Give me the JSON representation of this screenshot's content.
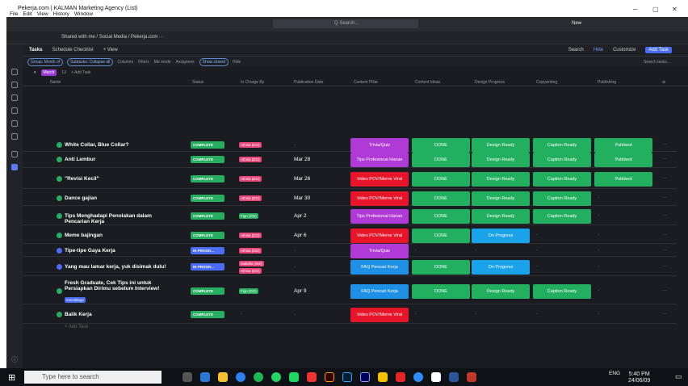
{
  "window": {
    "title": "Pekerja.com | KALMAN Marketing Agency (List)",
    "menu": [
      "File",
      "Edit",
      "View",
      "History",
      "Window"
    ]
  },
  "topbar": {
    "search_placeholder": "Q Search...",
    "new_label": "New"
  },
  "breadcrumb": "Shared with me / Social Media / Pekerja.com ···",
  "tabs": [
    "Tasks",
    "Schedule Checklist",
    "+ View"
  ],
  "toolbar_right": [
    "Search",
    "Hide",
    "Customize",
    "Add Task"
  ],
  "filters": {
    "chips": [
      "Group: Month of",
      "Subtasks: Collapse all",
      "Columns"
    ],
    "labels": [
      "Filters",
      "Me mode",
      "Assignees",
      "Show closed",
      "Hide"
    ],
    "search_placeholder": "Search tasks..."
  },
  "group": {
    "tag": "March",
    "count": "13",
    "add_label": "+ Add Task"
  },
  "headers": [
    "Name",
    "Status",
    "In Charge By",
    "Publication Date",
    "Content Pillar",
    "Content Ideas",
    "Design Progress",
    "Copywriting",
    "Publishing"
  ],
  "rows": [
    {
      "name": "White Collar, Blue Collar?",
      "status": "COMPLETE",
      "person": "Athisa (DG)",
      "date": "-",
      "pillar": "Trivia/Quiz",
      "idea": "DONE",
      "design": "Design Ready",
      "copy": "Caption Ready",
      "publish": "Publised"
    },
    {
      "name": "Anti Lembur",
      "status": "COMPLETE",
      "person": "Athisa (DG)",
      "date": "Mar 28",
      "pillar": "Tips Profesional Harian",
      "idea": "DONE",
      "design": "Design Ready",
      "copy": "Caption Ready",
      "publish": "Publised"
    },
    {
      "name": "\"Revisi Kecil\"",
      "status": "COMPLETE",
      "person": "Athisa (DG)",
      "date": "Mar 26",
      "pillar": "Video POV/Meme Viral",
      "idea": "DONE",
      "design": "Design Ready",
      "copy": "Caption Ready",
      "publish": "Publised"
    },
    {
      "name": "Dance gajian",
      "status": "COMPLETE",
      "person": "Athisa (DG)",
      "date": "Mar 30",
      "pillar": "Video POV/Meme Viral",
      "idea": "DONE",
      "design": "Design Ready",
      "copy": "Caption Ready",
      "publish": "-"
    },
    {
      "name": "Tips Menghadapi Penolakan dalam Pencarian Kerja",
      "status": "COMPLETE",
      "person": "Figo (DG)",
      "date": "Apr 2",
      "pillar": "Tips Profesional Harian",
      "idea": "DONE",
      "design": "Design Ready",
      "copy": "Caption Ready",
      "publish": "-"
    },
    {
      "name": "Meme bajingan",
      "status": "COMPLETE",
      "person": "Athisa (DG)",
      "date": "Apr 6",
      "pillar": "Video POV/Meme Viral",
      "idea": "DONE",
      "design": "On Progress",
      "copy": "-",
      "publish": "-"
    },
    {
      "name": "Tipe-tipe Gaya Kerja",
      "status": "IN PROGR...",
      "person": "Athisa (DG)",
      "date": "-",
      "pillar": "Trivia/Quiz",
      "idea": "-",
      "design": "-",
      "copy": "-",
      "publish": "-"
    },
    {
      "name": "Yang mau lamar kerja, yuk disimak dulu!",
      "status": "IN PROGR...",
      "person": "Isabella (SM)",
      "person2": "Athisa (DG)",
      "date": "-",
      "pillar": "FAQ Pencari Kerja",
      "idea": "DONE",
      "design": "On Progress",
      "copy": "-",
      "publish": "-"
    },
    {
      "name": "Fresh Graduate, Cek Tips ini untuk Persiapkan Dirimu sebelum Interview!",
      "tag": "microblogs",
      "status": "COMPLETE",
      "person": "Figo (DG)",
      "date": "Apr 9",
      "pillar": "FAQ Pencari Kerja",
      "idea": "DONE",
      "design": "Design Ready",
      "copy": "Caption Ready",
      "publish": "-"
    },
    {
      "name": "Balik Kerja",
      "status": "COMPLETE",
      "person": "-",
      "date": "-",
      "pillar": "Video POV/Meme Viral",
      "idea": "-",
      "design": "-",
      "copy": "-",
      "publish": "-"
    }
  ],
  "add_task": "+ Add Task",
  "taskbar": {
    "search_placeholder": "Type here to search",
    "lang": "ENG",
    "time": "5:40 PM",
    "date": "24/06/09"
  }
}
